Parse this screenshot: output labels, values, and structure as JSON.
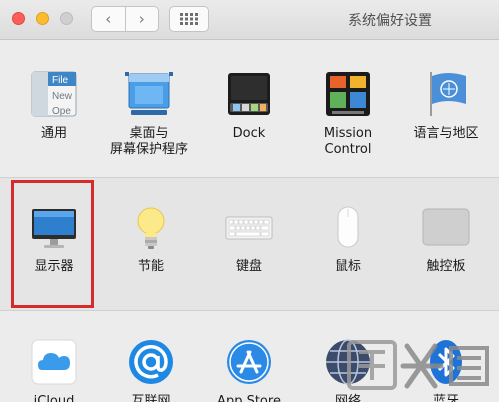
{
  "window": {
    "title": "系统偏好设置"
  },
  "toolbar": {
    "back": "‹",
    "forward": "›"
  },
  "panes_row1": [
    {
      "label": "通用"
    },
    {
      "label": "桌面与\n屏幕保护程序"
    },
    {
      "label": "Dock"
    },
    {
      "label": "Mission\nControl"
    },
    {
      "label": "语言与地区"
    }
  ],
  "general_icon_text": [
    "File",
    "New",
    "Ope"
  ],
  "panes_row2": [
    {
      "label": "显示器"
    },
    {
      "label": "节能"
    },
    {
      "label": "键盘"
    },
    {
      "label": "鼠标"
    },
    {
      "label": "触控板"
    }
  ],
  "panes_row3": [
    {
      "label": "iCloud"
    },
    {
      "label": "互联网"
    },
    {
      "label": "App Store"
    },
    {
      "label": "网络"
    },
    {
      "label": "蓝牙"
    }
  ],
  "colors": {
    "highlight": "#d62b2b",
    "accent": "#1e88e5"
  }
}
